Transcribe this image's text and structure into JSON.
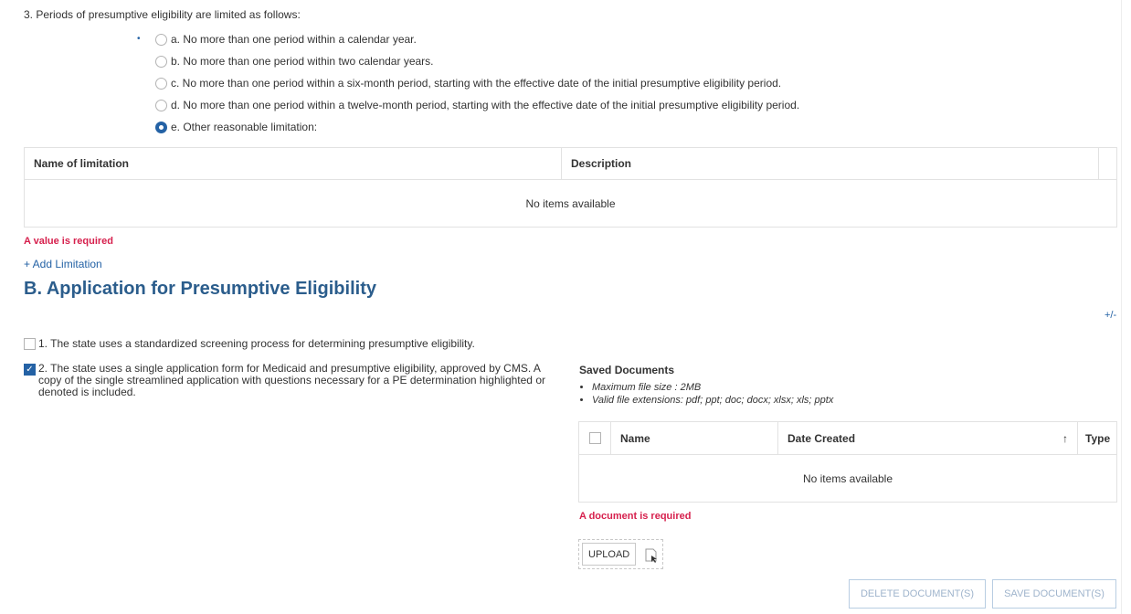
{
  "question3": {
    "text": "3. Periods of presumptive eligibility are limited as follows:",
    "required_marker": "•",
    "options": [
      {
        "label": "a. No more than one period within a calendar year.",
        "selected": false
      },
      {
        "label": "b. No more than one period within two calendar years.",
        "selected": false
      },
      {
        "label": "c. No more than one period within a six-month period, starting with the effective date of the initial presumptive eligibility period.",
        "selected": false
      },
      {
        "label": "d. No more than one period within a twelve-month period, starting with the effective date of the initial presumptive eligibility period.",
        "selected": false
      },
      {
        "label": "e. Other reasonable limitation:",
        "selected": true
      }
    ]
  },
  "limitations_grid": {
    "columns": [
      "Name of limitation",
      "Description"
    ],
    "empty_text": "No items available",
    "error": "A value is required",
    "add_link": "+ Add Limitation"
  },
  "sectionB": {
    "title": "B. Application for Presumptive Eligibility",
    "toggle": "+/-",
    "items": [
      {
        "label": "1. The state uses a standardized screening process for determining presumptive eligibility.",
        "checked": false
      },
      {
        "label": "2. The state uses a single application form for Medicaid and presumptive eligibility, approved by CMS. A copy of the single streamlined application with questions necessary for a PE determination highlighted or denoted is included.",
        "checked": true
      }
    ]
  },
  "documents": {
    "title": "Saved Documents",
    "notes": [
      "Maximum file size : 2MB",
      "Valid file extensions: pdf; ppt; doc; docx; xlsx; xls; pptx"
    ],
    "columns": [
      "Name",
      "Date Created",
      "Type"
    ],
    "sort_indicator": "↑",
    "empty_text": "No items available",
    "error": "A document is required",
    "upload_label": "UPLOAD",
    "delete_label": "DELETE DOCUMENT(S)",
    "save_label": "SAVE DOCUMENT(S)"
  },
  "colors": {
    "accent": "#2462a5",
    "error": "#d6204d",
    "section_title": "#2b5d8c",
    "disabled_button_text": "#9fb4cc"
  }
}
